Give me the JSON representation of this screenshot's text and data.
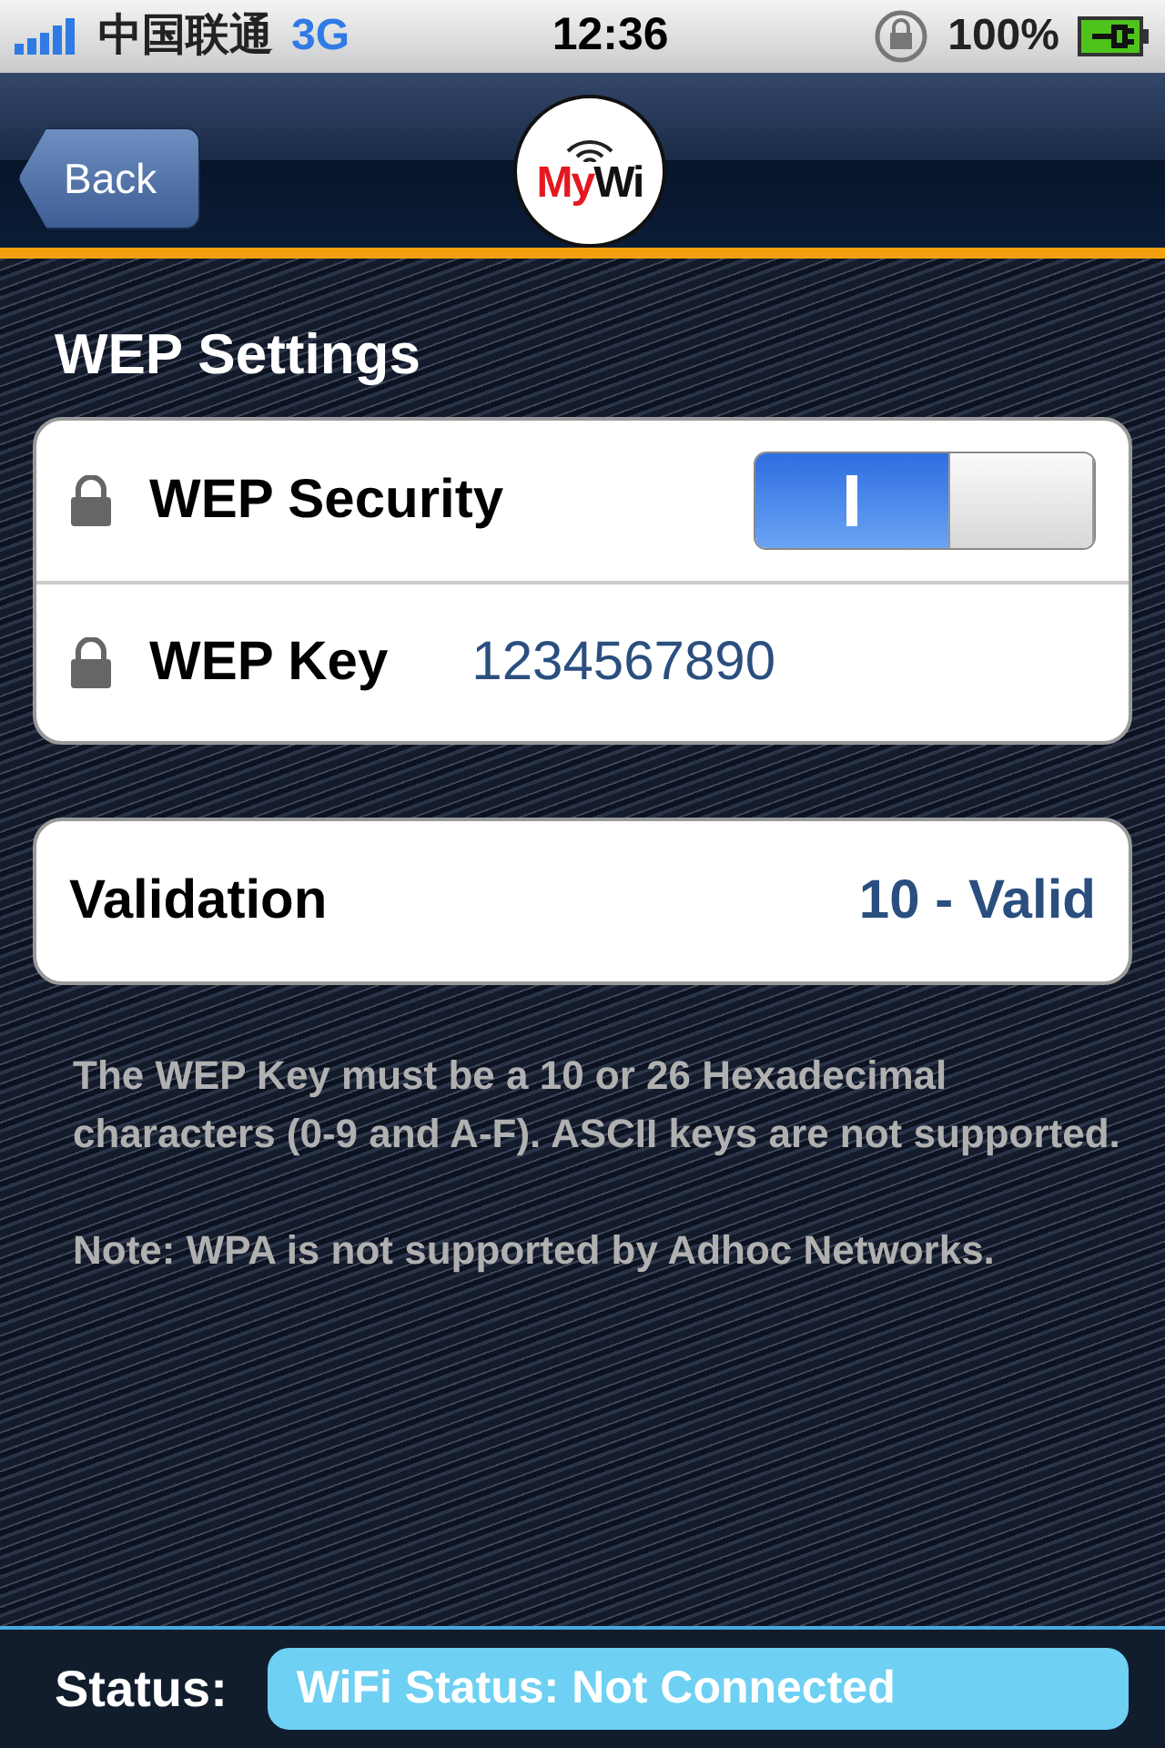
{
  "status_bar": {
    "carrier": "中国联通",
    "network": "3G",
    "time": "12:36",
    "battery": "100%"
  },
  "nav": {
    "back": "Back",
    "logo": {
      "first": "My",
      "second": "Wi"
    }
  },
  "section_title": "WEP Settings",
  "settings": [
    {
      "kind": "switch",
      "label": "WEP Security",
      "on": true
    },
    {
      "kind": "value",
      "label": "WEP Key",
      "value": "1234567890"
    }
  ],
  "validation": {
    "label": "Validation",
    "value": "10 - Valid"
  },
  "notes": [
    "The WEP Key must be a 10 or 26 Hexadecimal characters (0-9 and A-F). ASCII keys are not supported.",
    "Note: WPA is not supported by Adhoc Networks."
  ],
  "footer": {
    "label": "Status:",
    "value": "WiFi Status: Not Connected"
  }
}
